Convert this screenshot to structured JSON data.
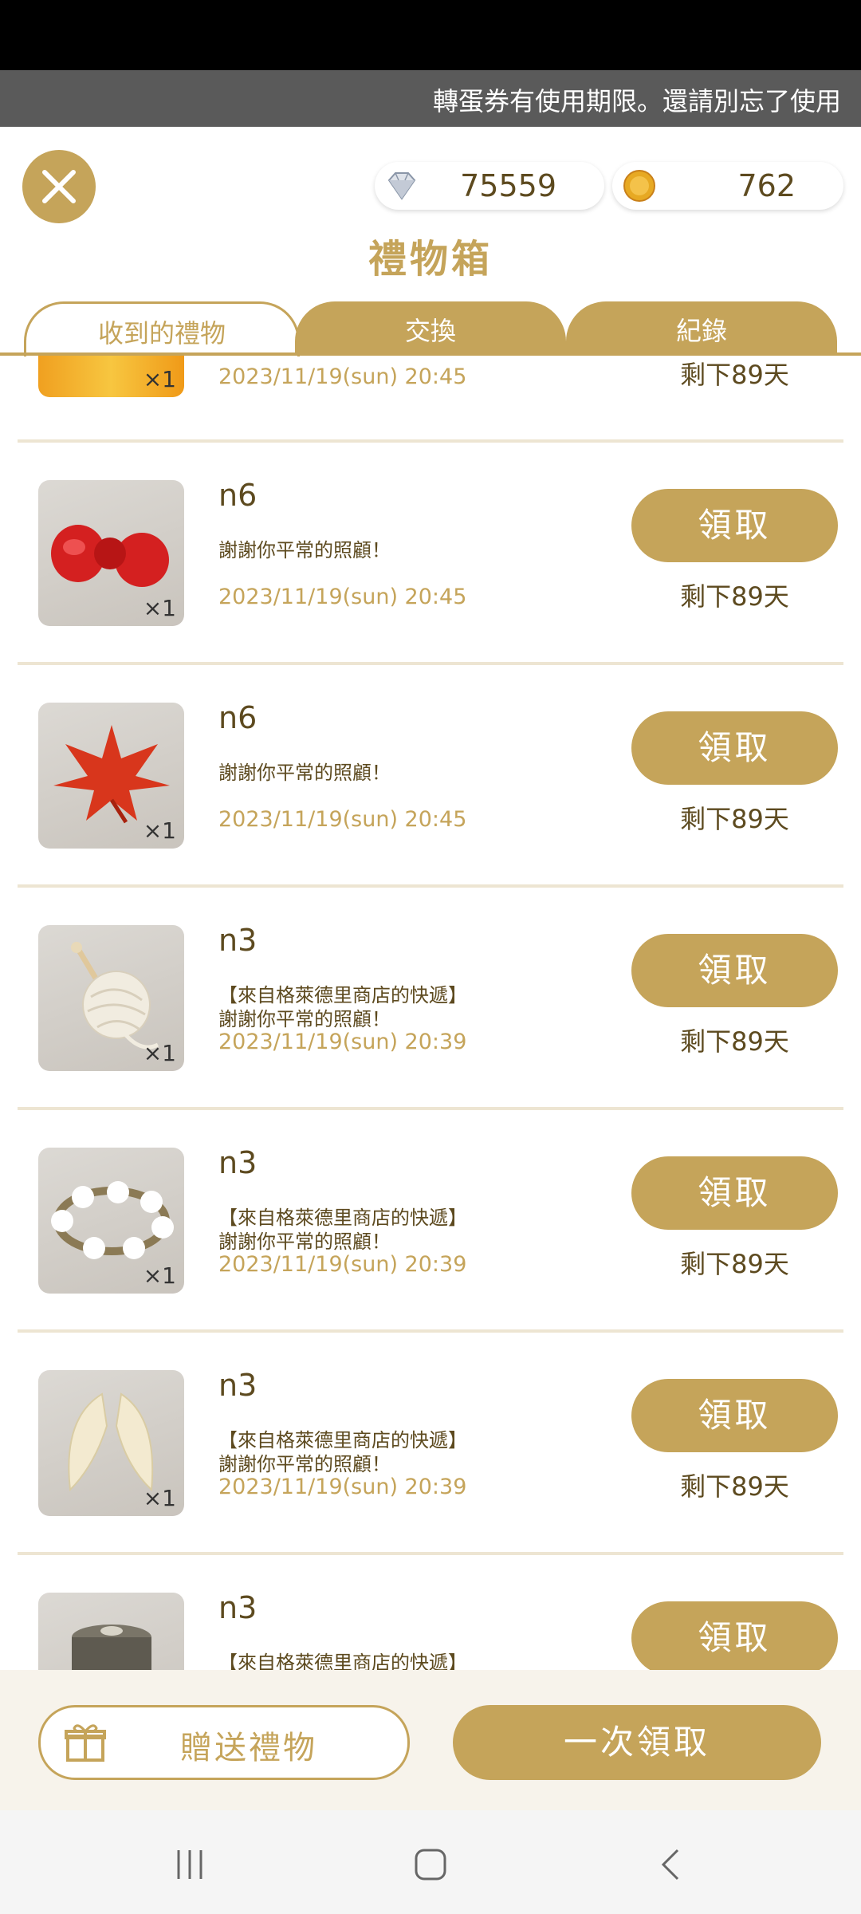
{
  "ticker": {
    "text": "轉蛋券有使用期限。還請別忘了使用"
  },
  "currency": {
    "diamonds": "75559",
    "coins": "762"
  },
  "header": {
    "title": "禮物箱"
  },
  "tabs": [
    {
      "label": "收到的禮物",
      "active": true
    },
    {
      "label": "交換",
      "active": false
    },
    {
      "label": "紀錄",
      "active": false
    }
  ],
  "partial_item": {
    "qty": "×1",
    "date": "2023/11/19(sun) 20:45",
    "remaining": "剩下89天"
  },
  "items": [
    {
      "sender": "n6",
      "message": "謝謝你平常的照顧！",
      "date": "2023/11/19(sun) 20:45",
      "qty": "×1",
      "remaining": "剩下89天",
      "claim_label": "領取",
      "icon": "red-ribbon-icon"
    },
    {
      "sender": "n6",
      "message": "謝謝你平常的照顧！",
      "date": "2023/11/19(sun) 20:45",
      "qty": "×1",
      "remaining": "剩下89天",
      "claim_label": "領取",
      "icon": "maple-leaf-icon"
    },
    {
      "sender": "n3",
      "message": "【來自格萊德里商店的快遞】\n謝謝你平常的照顧！",
      "date": "2023/11/19(sun) 20:39",
      "qty": "×1",
      "remaining": "剩下89天",
      "claim_label": "領取",
      "icon": "yarn-ball-icon"
    },
    {
      "sender": "n3",
      "message": "【來自格萊德里商店的快遞】\n謝謝你平常的照顧！",
      "date": "2023/11/19(sun) 20:39",
      "qty": "×1",
      "remaining": "剩下89天",
      "claim_label": "領取",
      "icon": "flower-wreath-icon"
    },
    {
      "sender": "n3",
      "message": "【來自格萊德里商店的快遞】\n謝謝你平常的照顧！",
      "date": "2023/11/19(sun) 20:39",
      "qty": "×1",
      "remaining": "剩下89天",
      "claim_label": "領取",
      "icon": "claws-icon"
    },
    {
      "sender": "n3",
      "message": "【來自格萊德里商店的快遞】",
      "date": "",
      "qty": "",
      "remaining": "",
      "claim_label": "領取",
      "icon": "pot-icon"
    }
  ],
  "footer": {
    "gift_label": "贈送禮物",
    "claim_all_label": "一次領取"
  },
  "colors": {
    "accent": "#c5a45a",
    "text_brown": "#5d4a1f",
    "divider": "#ede5d2"
  }
}
